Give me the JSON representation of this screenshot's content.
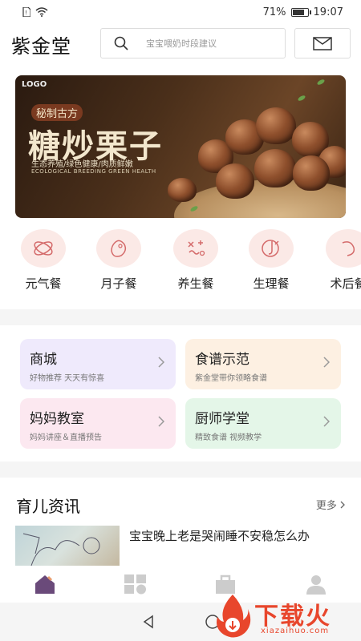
{
  "status_bar": {
    "battery_text": "71%",
    "battery_level": 0.71,
    "time": "19:07"
  },
  "header": {
    "app_title": "紫金堂",
    "search_placeholder": "宝宝喂奶时段建议"
  },
  "banner": {
    "logo": "LOGO",
    "tag": "秘制古方",
    "headline": "糖炒栗子",
    "subtitle": "生态养殖/绿色健康/肉质鲜嫩",
    "subtitle_en": "ECOLOGICAL BREEDING GREEN HEALTH"
  },
  "categories": [
    {
      "label": "元气餐",
      "icon": "atom-icon"
    },
    {
      "label": "月子餐",
      "icon": "bean-icon"
    },
    {
      "label": "养生餐",
      "icon": "cross-icon"
    },
    {
      "label": "生理餐",
      "icon": "circle-hook-icon"
    },
    {
      "label": "术后餐",
      "icon": "partial-icon"
    }
  ],
  "grid": [
    {
      "title": "商城",
      "sub": "好物推荐 天天有惊喜",
      "color": "#efeafc"
    },
    {
      "title": "食谱示范",
      "sub": "紫金堂带你领略食谱",
      "color": "#fdf0e2"
    },
    {
      "title": "妈妈教室",
      "sub": "妈妈讲座＆直播预告",
      "color": "#fce8f0"
    },
    {
      "title": "厨师学堂",
      "sub": "精致食谱 视频教学",
      "color": "#e4f6e8"
    }
  ],
  "news": {
    "title": "育儿资讯",
    "more": "更多",
    "items": [
      {
        "title": "宝宝晚上老是哭闹睡不安稳怎么办"
      }
    ]
  },
  "tabs": [
    {
      "icon": "home-icon",
      "active": true
    },
    {
      "icon": "grid-icon",
      "active": false
    },
    {
      "icon": "bag-icon",
      "active": false
    },
    {
      "icon": "person-icon",
      "active": false
    }
  ],
  "watermark": {
    "text": "下载火",
    "sub": "xiazaihuo.com"
  },
  "colors": {
    "accent": "#6a4a7a",
    "watermark": "#e8462c"
  }
}
